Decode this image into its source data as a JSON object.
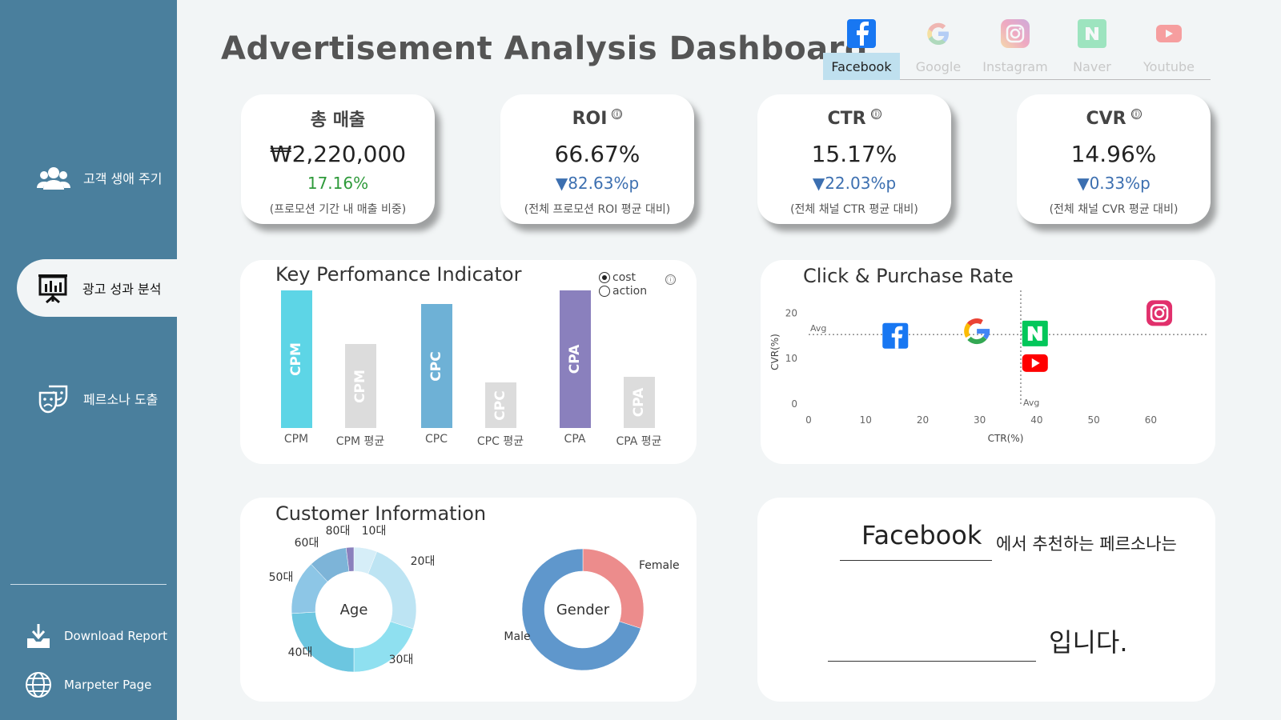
{
  "sidebar": {
    "items": [
      {
        "label": "고객 생애 주기",
        "icon": "people-icon"
      },
      {
        "label": "광고 성과 분석",
        "icon": "presentation-chart-icon"
      },
      {
        "label": "페르소나 도출",
        "icon": "theater-masks-icon"
      }
    ],
    "active_index": 1,
    "links": [
      {
        "label": "Download Report",
        "icon": "download-icon"
      },
      {
        "label": "Marpeter Page",
        "icon": "globe-icon"
      }
    ]
  },
  "header": {
    "title": "Advertisement Analysis Dashboard"
  },
  "channels": [
    {
      "label": "Facebook",
      "icon": "facebook-icon",
      "active": true
    },
    {
      "label": "Google",
      "icon": "google-icon",
      "active": false
    },
    {
      "label": "Instagram",
      "icon": "instagram-icon",
      "active": false
    },
    {
      "label": "Naver",
      "icon": "naver-icon",
      "active": false
    },
    {
      "label": "Youtube",
      "icon": "youtube-icon",
      "active": false
    }
  ],
  "kpis": [
    {
      "title": "총 매출",
      "value": "₩2,220,000",
      "change": "17.16%",
      "direction": "up",
      "note": "(프로모션 기간 내 매출 비중)",
      "info": false
    },
    {
      "title": "ROI",
      "value": "66.67%",
      "change": "▼82.63%p",
      "direction": "down",
      "note": "(전체 프로모션 ROI 평균 대비)",
      "info": true
    },
    {
      "title": "CTR",
      "value": "15.17%",
      "change": "▼22.03%p",
      "direction": "down",
      "note": "(전체 채널 CTR 평균 대비)",
      "info": true
    },
    {
      "title": "CVR",
      "value": "14.96%",
      "change": "▼0.33%p",
      "direction": "down",
      "note": "(전체 채널 CVR 평균 대비)",
      "info": true
    }
  ],
  "kpi_panel": {
    "title": "Key Perfomance Indicator",
    "toggle": [
      {
        "label": "cost",
        "selected": true
      },
      {
        "label": "action",
        "selected": false
      }
    ],
    "info_glyph": "ⓘ"
  },
  "click_panel": {
    "title": "Click & Purchase Rate"
  },
  "customer_panel": {
    "title": "Customer Information"
  },
  "persona": {
    "channel": "Facebook",
    "suffix": "에서 추천하는 페르소나는",
    "ending": "입니다."
  },
  "colors": {
    "sidebar": "#4a7f9d",
    "accent_active": "#bfe0ef",
    "up": "#2e9a3a",
    "down": "#3c6fb0"
  },
  "chart_data": [
    {
      "type": "bar",
      "categories": [
        "CPM",
        "CPM 평균",
        "CPC",
        "CPC 평균",
        "CPA",
        "CPA 평균"
      ],
      "values": [
        100,
        61,
        90,
        33,
        100,
        37
      ],
      "bar_labels": [
        "CPM",
        "CPM",
        "CPC",
        "CPC",
        "CPA",
        "CPA"
      ],
      "colors": [
        "#5dd5e6",
        "#dcdcdc",
        "#6eb1d6",
        "#dcdcdc",
        "#8a80bd",
        "#dcdcdc"
      ],
      "title": "",
      "ylim": [
        0,
        100
      ]
    },
    {
      "type": "scatter",
      "xlabel": "CTR(%)",
      "ylabel": "CVR(%)",
      "xlim": [
        0,
        65
      ],
      "ylim": [
        0,
        22
      ],
      "xticks": [
        0,
        10,
        20,
        30,
        40,
        50,
        60
      ],
      "yticks": [
        0,
        10,
        20
      ],
      "points": [
        {
          "icon": "facebook-icon",
          "x": 15.2,
          "y": 15.0
        },
        {
          "icon": "google-icon",
          "x": 29.5,
          "y": 16.0
        },
        {
          "icon": "naver-icon",
          "x": 39.7,
          "y": 15.5
        },
        {
          "icon": "youtube-icon",
          "x": 39.7,
          "y": 9.0
        },
        {
          "icon": "instagram-icon",
          "x": 61.5,
          "y": 20.0
        }
      ],
      "avg_x": 37.2,
      "avg_y": 15.3,
      "avg_label": "Avg"
    },
    {
      "type": "pie",
      "center_label": "Age",
      "categories": [
        "10대",
        "20대",
        "30대",
        "40대",
        "50대",
        "60대",
        "80대"
      ],
      "values": [
        6,
        24,
        20,
        24,
        14,
        10,
        2
      ],
      "colors": [
        "#d6eef8",
        "#bde4f3",
        "#8fe0f0",
        "#6cc6e0",
        "#8dc6e6",
        "#7db4d8",
        "#8a80bd"
      ]
    },
    {
      "type": "pie",
      "center_label": "Gender",
      "categories": [
        "Female",
        "Male"
      ],
      "values": [
        30,
        70
      ],
      "colors": [
        "#ec8c8c",
        "#5f97cc"
      ]
    }
  ]
}
